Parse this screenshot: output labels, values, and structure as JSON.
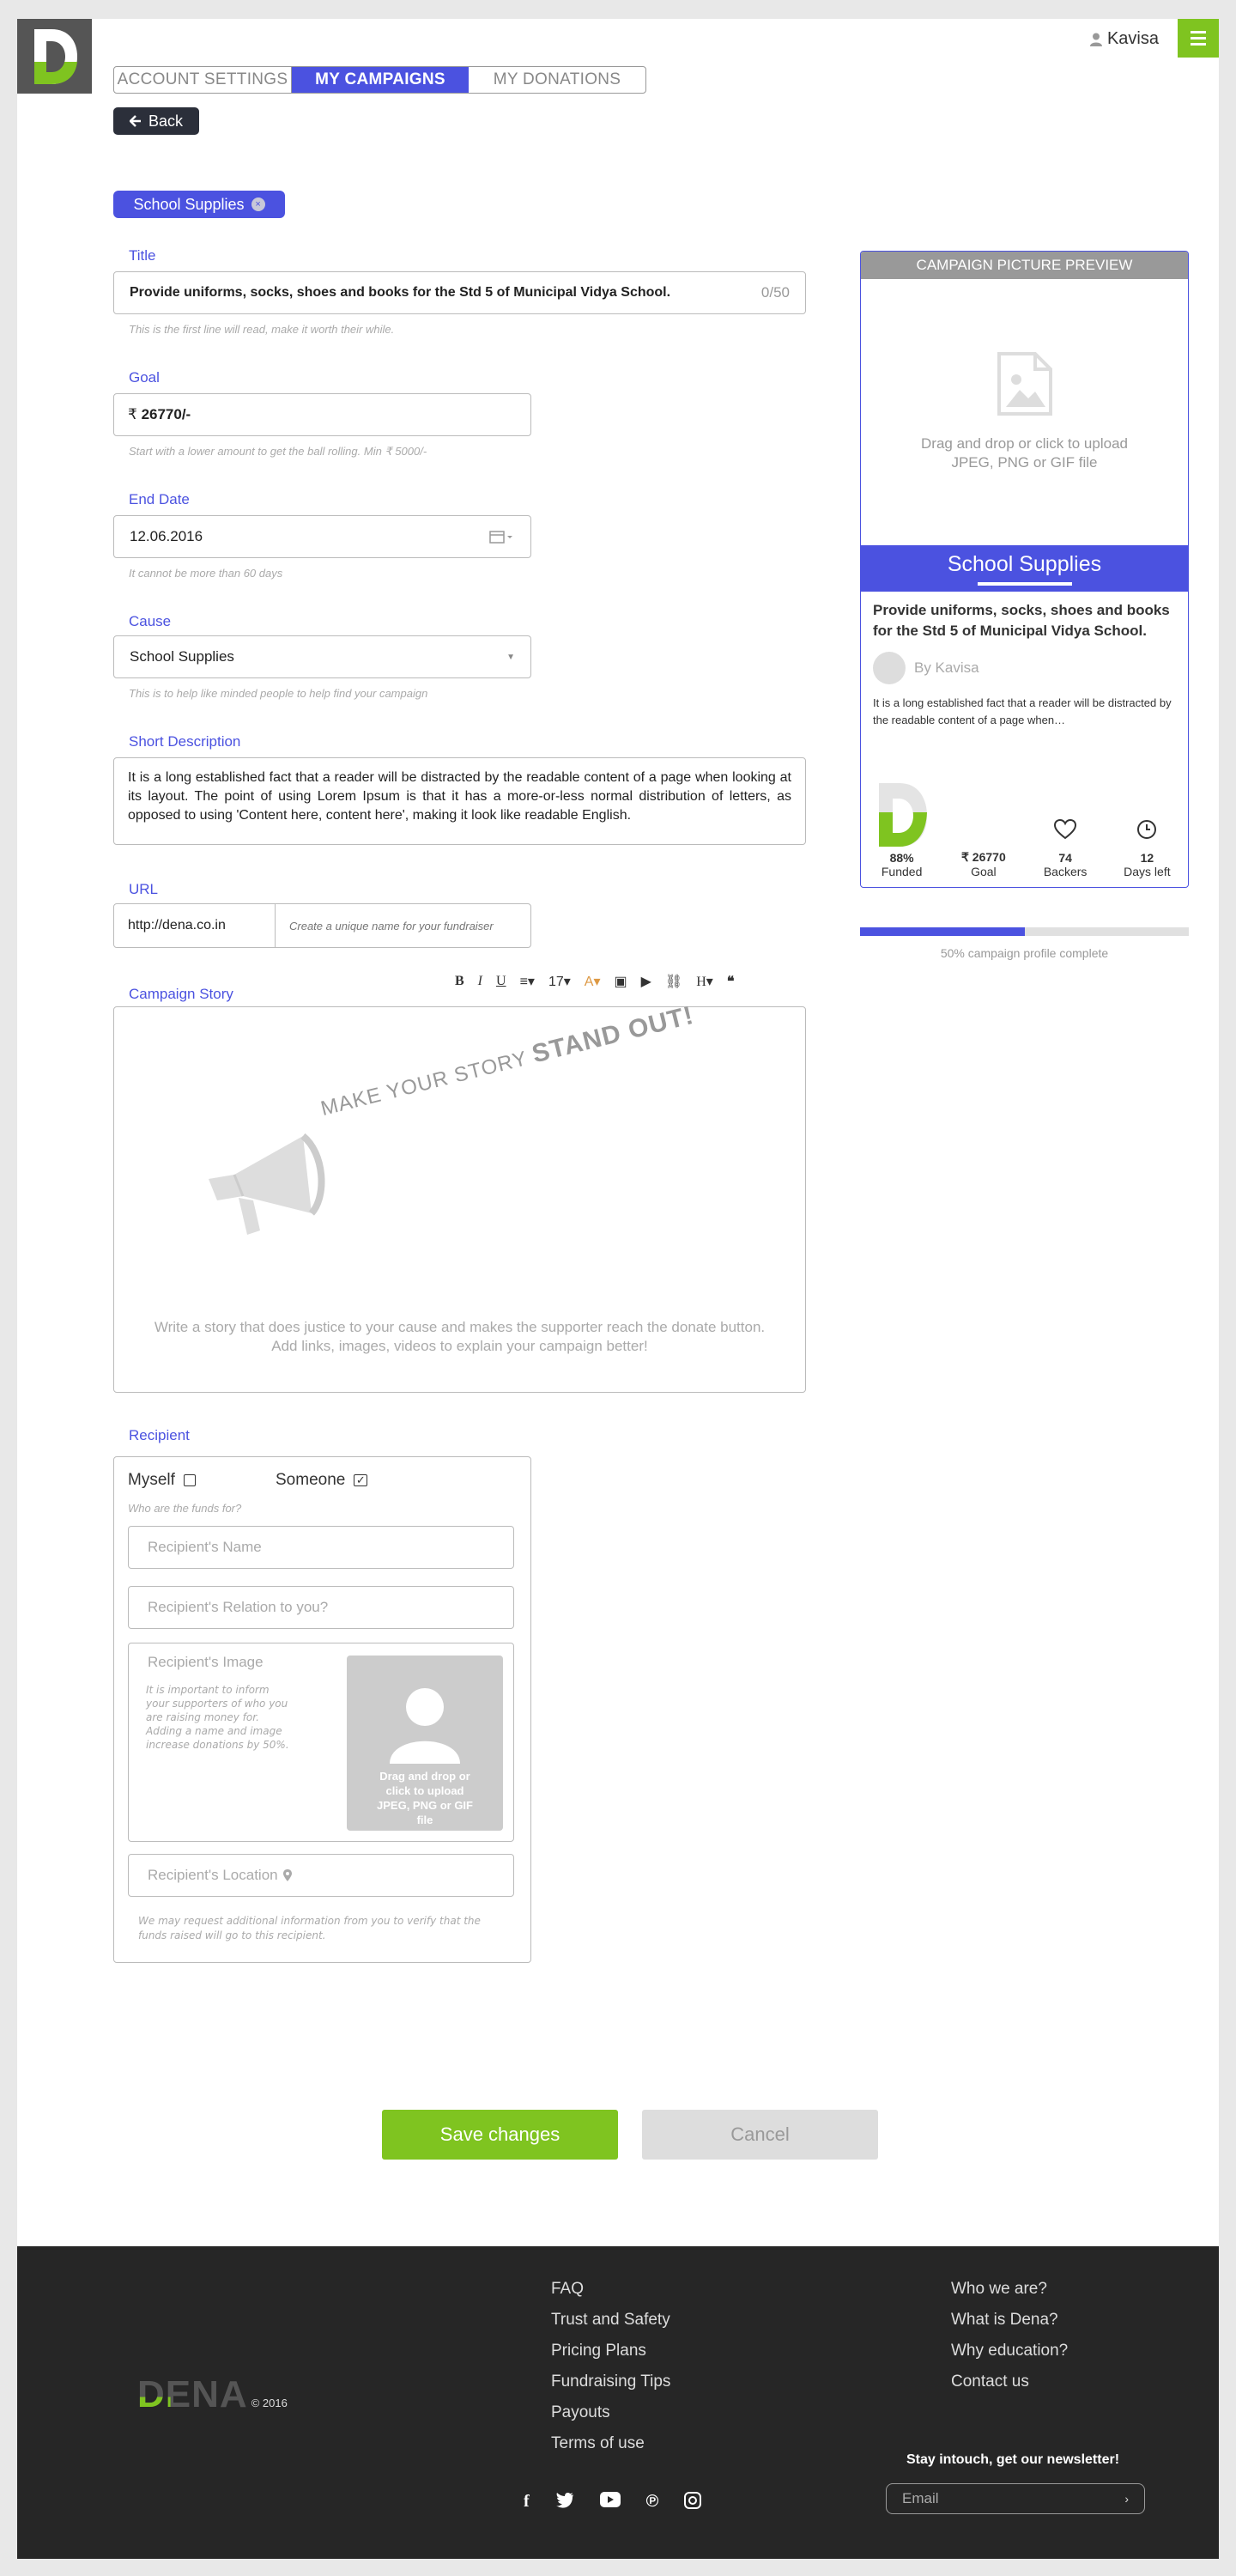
{
  "header": {
    "user_name": "Kavisa"
  },
  "tabs": [
    {
      "label": "ACCOUNT SETTINGS"
    },
    {
      "label": "MY CAMPAIGNS"
    },
    {
      "label": "MY DONATIONS"
    }
  ],
  "back_label": "Back",
  "category_pill": {
    "label": "School Supplies"
  },
  "form": {
    "title": {
      "label": "Title",
      "value": "Provide uniforms, socks, shoes and books for the Std 5 of Municipal Vidya School.",
      "counter": "0/50",
      "hint": "This is the first line will read, make it worth their while."
    },
    "goal": {
      "label": "Goal",
      "currency": "₹",
      "value": "26770/-",
      "hint": "Start with a lower amount to get the ball rolling. Min ₹ 5000/-"
    },
    "end_date": {
      "label": "End Date",
      "value": "12.06.2016",
      "hint": "It cannot be more than 60 days"
    },
    "cause": {
      "label": "Cause",
      "value": "School Supplies",
      "hint": "This is to help like minded people to help find your campaign"
    },
    "short_description": {
      "label": "Short Description",
      "value": "It is a long established fact that a reader will be distracted by the readable content of a page when looking at its layout. The point of using Lorem Ipsum is that it has a more-or-less normal distribution of letters, as opposed to using 'Content here, content here', making it look like readable English."
    },
    "url": {
      "label": "URL",
      "prefix": "http://dena.co.in",
      "placeholder": "Create a unique name for your fundraiser"
    },
    "story": {
      "label": "Campaign Story",
      "tagline_a": "MAKE YOUR STORY",
      "tagline_b": "STAND OUT",
      "tagline_c": "!",
      "hint_line1": "Write a story that does justice to your cause and makes the supporter reach the donate button.",
      "hint_line2": "Add links, images, videos to explain your campaign better!",
      "font_size": "17"
    }
  },
  "recipient": {
    "label": "Recipient",
    "myself_label": "Myself",
    "someone_label": "Someone",
    "question": "Who are the funds for?",
    "name_placeholder": "Recipient's Name",
    "relation_placeholder": "Recipient's Relation to you?",
    "image_label": "Recipient's Image",
    "image_note": "It is important to inform your supporters of who you are raising money for. Adding a name and image increase donations by 50%.",
    "upload_text": "Drag and drop or click to upload JPEG, PNG or GIF file",
    "location_placeholder": "Recipient's Location",
    "verify_note": "We may request additional information from you to verify that the funds raised will go to this recipient."
  },
  "preview": {
    "header": "CAMPAIGN PICTURE PREVIEW",
    "upload_line1": "Drag and drop or click to upload",
    "upload_line2": "JPEG, PNG or GIF file",
    "category": "School Supplies",
    "title": "Provide uniforms, socks, shoes and books for the Std 5 of Municipal Vidya School.",
    "by": "By Kavisa",
    "description": "It is a long established fact that a reader will be distracted by the readable content of a page when…",
    "funded_value": "88%",
    "funded_label": "Funded",
    "goal_value": "₹ 26770",
    "goal_label": "Goal",
    "backers_value": "74",
    "backers_label": "Backers",
    "days_value": "12",
    "days_label": "Days left",
    "progress_percent": 50,
    "progress_text": "50% campaign profile complete"
  },
  "actions": {
    "save": "Save changes",
    "cancel": "Cancel"
  },
  "footer": {
    "brand": "DENA",
    "copyright": "© 2016",
    "links_col1": [
      "FAQ",
      "Trust and Safety",
      "Pricing Plans",
      "Fundraising Tips",
      "Payouts",
      "Terms of use"
    ],
    "links_col2": [
      "Who we are?",
      "What is Dena?",
      "Why education?",
      "Contact us"
    ],
    "newsletter": "Stay intouch, get our newsletter!",
    "email_placeholder": "Email"
  },
  "colors": {
    "accent": "#4b52e0",
    "brand_green": "#7fc420",
    "footer_bg": "#262626"
  }
}
